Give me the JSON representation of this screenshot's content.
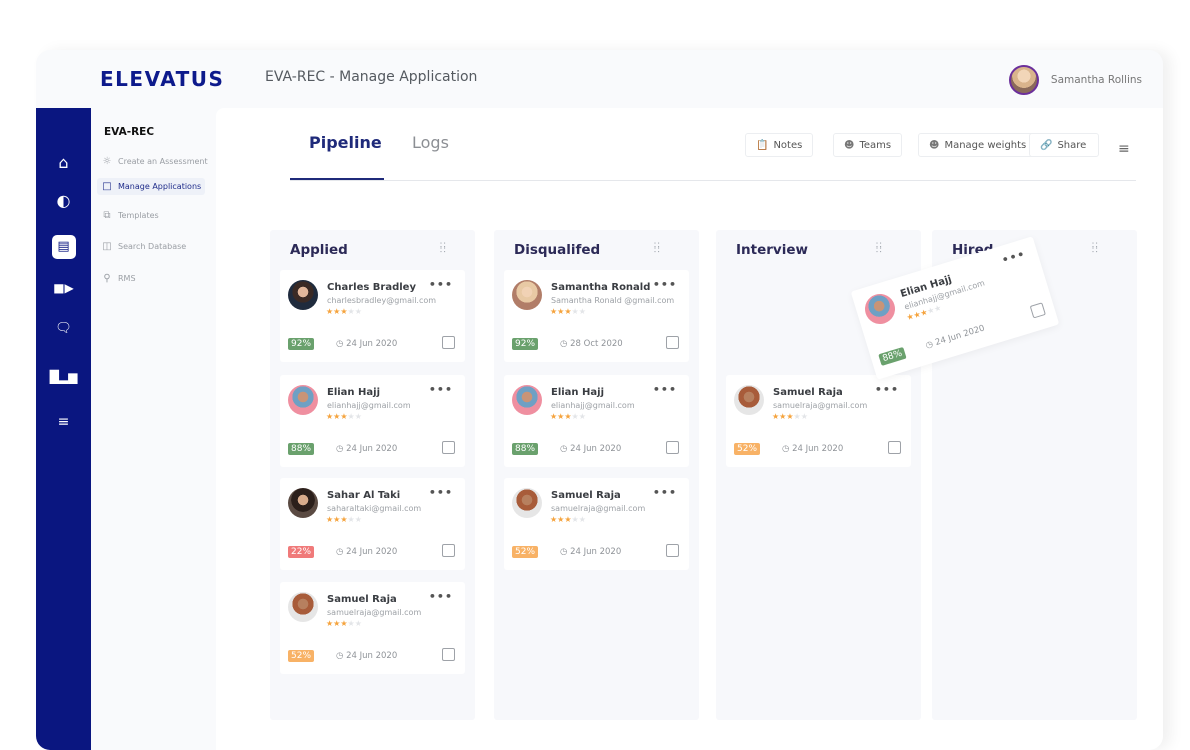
{
  "app": {
    "logo": "ELEVATUS",
    "title": "EVA-REC - Manage Application",
    "user_name": "Samantha Rollins"
  },
  "rail": {
    "icons": [
      "home-icon",
      "contrast-icon",
      "briefcase-icon",
      "video-icon",
      "chat-icon",
      "chart-icon",
      "sliders-icon"
    ],
    "active_index": 2
  },
  "subnav": {
    "title": "EVA-REC",
    "items": [
      {
        "label": "Create an Assessment",
        "icon": "lightbulb-icon"
      },
      {
        "label": "Manage Applications",
        "icon": "folder-icon",
        "active": true
      },
      {
        "label": "Templates",
        "icon": "templates-icon"
      },
      {
        "label": "Search Database",
        "icon": "database-search-icon"
      },
      {
        "label": "RMS",
        "icon": "document-search-icon"
      }
    ]
  },
  "tabs": [
    {
      "label": "Pipeline",
      "active": true
    },
    {
      "label": "Logs",
      "active": false
    }
  ],
  "toolbar": {
    "notes": "Notes",
    "teams": "Teams",
    "weights": "Manage weights",
    "share": "Share"
  },
  "colors": {
    "brand": "#0a1680",
    "score_high": "#6aa16d",
    "score_low": "#f07a7a",
    "score_mid": "#f8b266",
    "star": "#f5a33d"
  },
  "columns": [
    {
      "title": "Applied",
      "cards": [
        {
          "name": "Charles Bradley",
          "email": "charlesbradley@gmail.com",
          "stars": 3,
          "score": "92%",
          "level": "high",
          "date": "24 Jun 2020",
          "avatar": "charles"
        },
        {
          "name": "Elian Hajj",
          "email": "elianhajj@gmail.com",
          "stars": 3,
          "score": "88%",
          "level": "high",
          "date": "24 Jun 2020",
          "avatar": "elian"
        },
        {
          "name": "Sahar Al Taki",
          "email": "saharaltaki@gmail.com",
          "stars": 3,
          "score": "22%",
          "level": "low",
          "date": "24 Jun 2020",
          "avatar": "sahar"
        },
        {
          "name": "Samuel Raja",
          "email": "samuelraja@gmail.com",
          "stars": 3,
          "score": "52%",
          "level": "mid",
          "date": "24 Jun 2020",
          "avatar": "samuel"
        }
      ]
    },
    {
      "title": "Disqualifed",
      "cards": [
        {
          "name": "Samantha Ronald",
          "email": "Samantha Ronald @gmail.com",
          "stars": 3,
          "score": "92%",
          "level": "high",
          "date": "28 Oct 2020",
          "avatar": "samantha"
        },
        {
          "name": "Elian Hajj",
          "email": "elianhajj@gmail.com",
          "stars": 3,
          "score": "88%",
          "level": "high",
          "date": "24 Jun 2020",
          "avatar": "elian"
        },
        {
          "name": "Samuel Raja",
          "email": "samuelraja@gmail.com",
          "stars": 3,
          "score": "52%",
          "level": "mid",
          "date": "24 Jun 2020",
          "avatar": "samuel"
        }
      ]
    },
    {
      "title": "Interview",
      "cards": [
        {
          "name": "Samuel Raja",
          "email": "samuelraja@gmail.com",
          "stars": 3,
          "score": "52%",
          "level": "mid",
          "date": "24 Jun 2020",
          "avatar": "samuel"
        }
      ]
    },
    {
      "title": "Hired",
      "cards": []
    }
  ],
  "dragging_card": {
    "name": "Elian Hajj",
    "email": "elianhajj@gmail.com",
    "stars": 3,
    "score": "88%",
    "level": "high",
    "date": "24 Jun 2020",
    "avatar": "elian"
  }
}
